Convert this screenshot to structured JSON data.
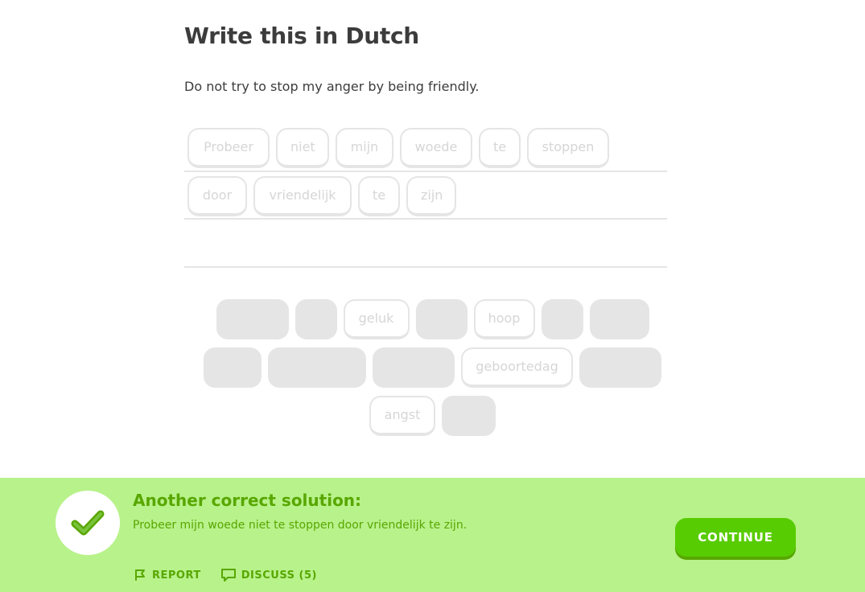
{
  "challenge": {
    "title": "Write this in Dutch",
    "prompt": "Do not try to stop my anger by being friendly."
  },
  "answer": {
    "rows": [
      [
        "Probeer",
        "niet",
        "mijn",
        "woede",
        "te",
        "stoppen"
      ],
      [
        "door",
        "vriendelijk",
        "te",
        "zijn"
      ]
    ]
  },
  "word_bank": {
    "rows": [
      [
        "",
        "",
        "geluk",
        "",
        "hoop",
        "",
        ""
      ],
      [
        "",
        "",
        "",
        "geboortedag",
        ""
      ],
      [
        "angst",
        ""
      ]
    ]
  },
  "feedback": {
    "status": "correct",
    "title": "Another correct solution:",
    "solution": "Probeer mijn woede niet te stoppen door vriendelijk te zijn.",
    "report_label": "REPORT",
    "discuss_label": "DISCUSS (5)",
    "continue_label": "CONTINUE",
    "icons": {
      "status": "checkmark-icon",
      "report": "flag-icon",
      "discuss": "comment-icon"
    },
    "colors": {
      "background": "#b8f28b",
      "text": "#58a700",
      "button": "#58cc02"
    }
  }
}
